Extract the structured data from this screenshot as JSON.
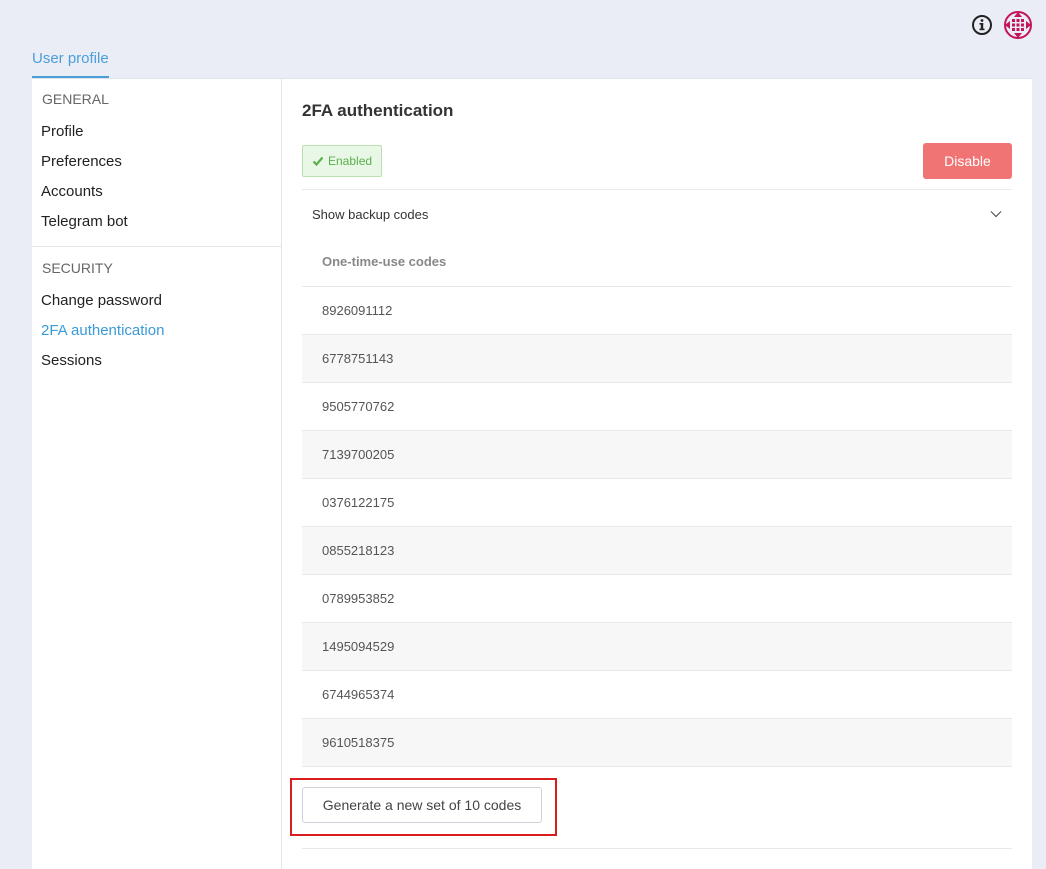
{
  "header": {
    "info_icon": "info-circle-icon",
    "avatar_icon": "user-avatar-icon",
    "avatar_color": "#c4145a"
  },
  "tabs": [
    {
      "label": "User profile",
      "active": true
    }
  ],
  "sidebar": {
    "sections": [
      {
        "heading": "GENERAL",
        "items": [
          "Profile",
          "Preferences",
          "Accounts",
          "Telegram bot"
        ]
      },
      {
        "heading": "SECURITY",
        "items": [
          "Change password",
          "2FA authentication",
          "Sessions"
        ]
      }
    ],
    "active_item": "2FA authentication",
    "accent_color": "#3a9ad9"
  },
  "main": {
    "title": "2FA authentication",
    "status_badge": "Enabled",
    "status_color": "#5ab04c",
    "disable_button": "Disable",
    "disable_color": "#f07474",
    "accordion_label": "Show backup codes",
    "codes_header": "One-time-use codes",
    "codes": [
      "8926091112",
      "6778751143",
      "9505770762",
      "7139700205",
      "0376122175",
      "0855218123",
      "0789953852",
      "1495094529",
      "6744965374",
      "9610518375"
    ],
    "generate_button": "Generate a new set of 10 codes"
  }
}
